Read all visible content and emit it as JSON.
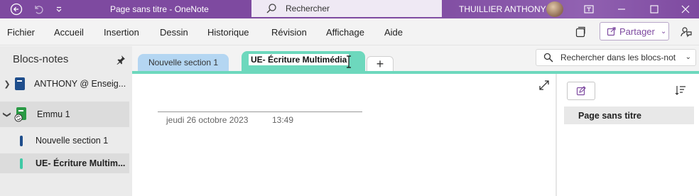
{
  "titlebar": {
    "title": "Page sans titre  -  OneNote",
    "search_placeholder": "Rechercher",
    "user_name": "THUILLIER ANTHONY",
    "icons": [
      "back-icon",
      "undo-icon",
      "quick-access-chevron-icon",
      "search-icon",
      "restore-window-icon",
      "minimize-icon",
      "maximize-icon",
      "close-icon"
    ]
  },
  "menu": {
    "items": [
      "Fichier",
      "Accueil",
      "Insertion",
      "Dessin",
      "Historique",
      "Révision",
      "Affichage",
      "Aide"
    ],
    "share_label": "Partager"
  },
  "sidebar": {
    "heading": "Blocs-notes",
    "notebooks": [
      {
        "label": "ANTHONY @ Enseig...",
        "color": "#1f4e8c",
        "expanded": false
      },
      {
        "label": "Emmu 1",
        "color": "#2a9a45",
        "expanded": true
      }
    ],
    "sections": [
      {
        "label": "Nouvelle section 1",
        "color": "#1f4e8c",
        "selected": false
      },
      {
        "label": "UE- Écriture Multim...",
        "color": "#3fc9a5",
        "selected": true
      }
    ]
  },
  "tabs": {
    "items": [
      {
        "label": "Nouvelle section 1",
        "color": "#b4d6f2"
      },
      {
        "label": "UE- Écriture Multimédia",
        "color": "#6dd8bd"
      }
    ],
    "add_label": "+",
    "search_placeholder": "Rechercher dans les blocs-not"
  },
  "page": {
    "date": "jeudi 26 octobre 2023",
    "time": "13:49"
  },
  "pagelist": {
    "pages": [
      "Page sans titre"
    ]
  },
  "colors": {
    "accent": "#7e4aa0",
    "section_tab_active": "#6dd8bd",
    "section_tab_inactive": "#b4d6f2"
  }
}
